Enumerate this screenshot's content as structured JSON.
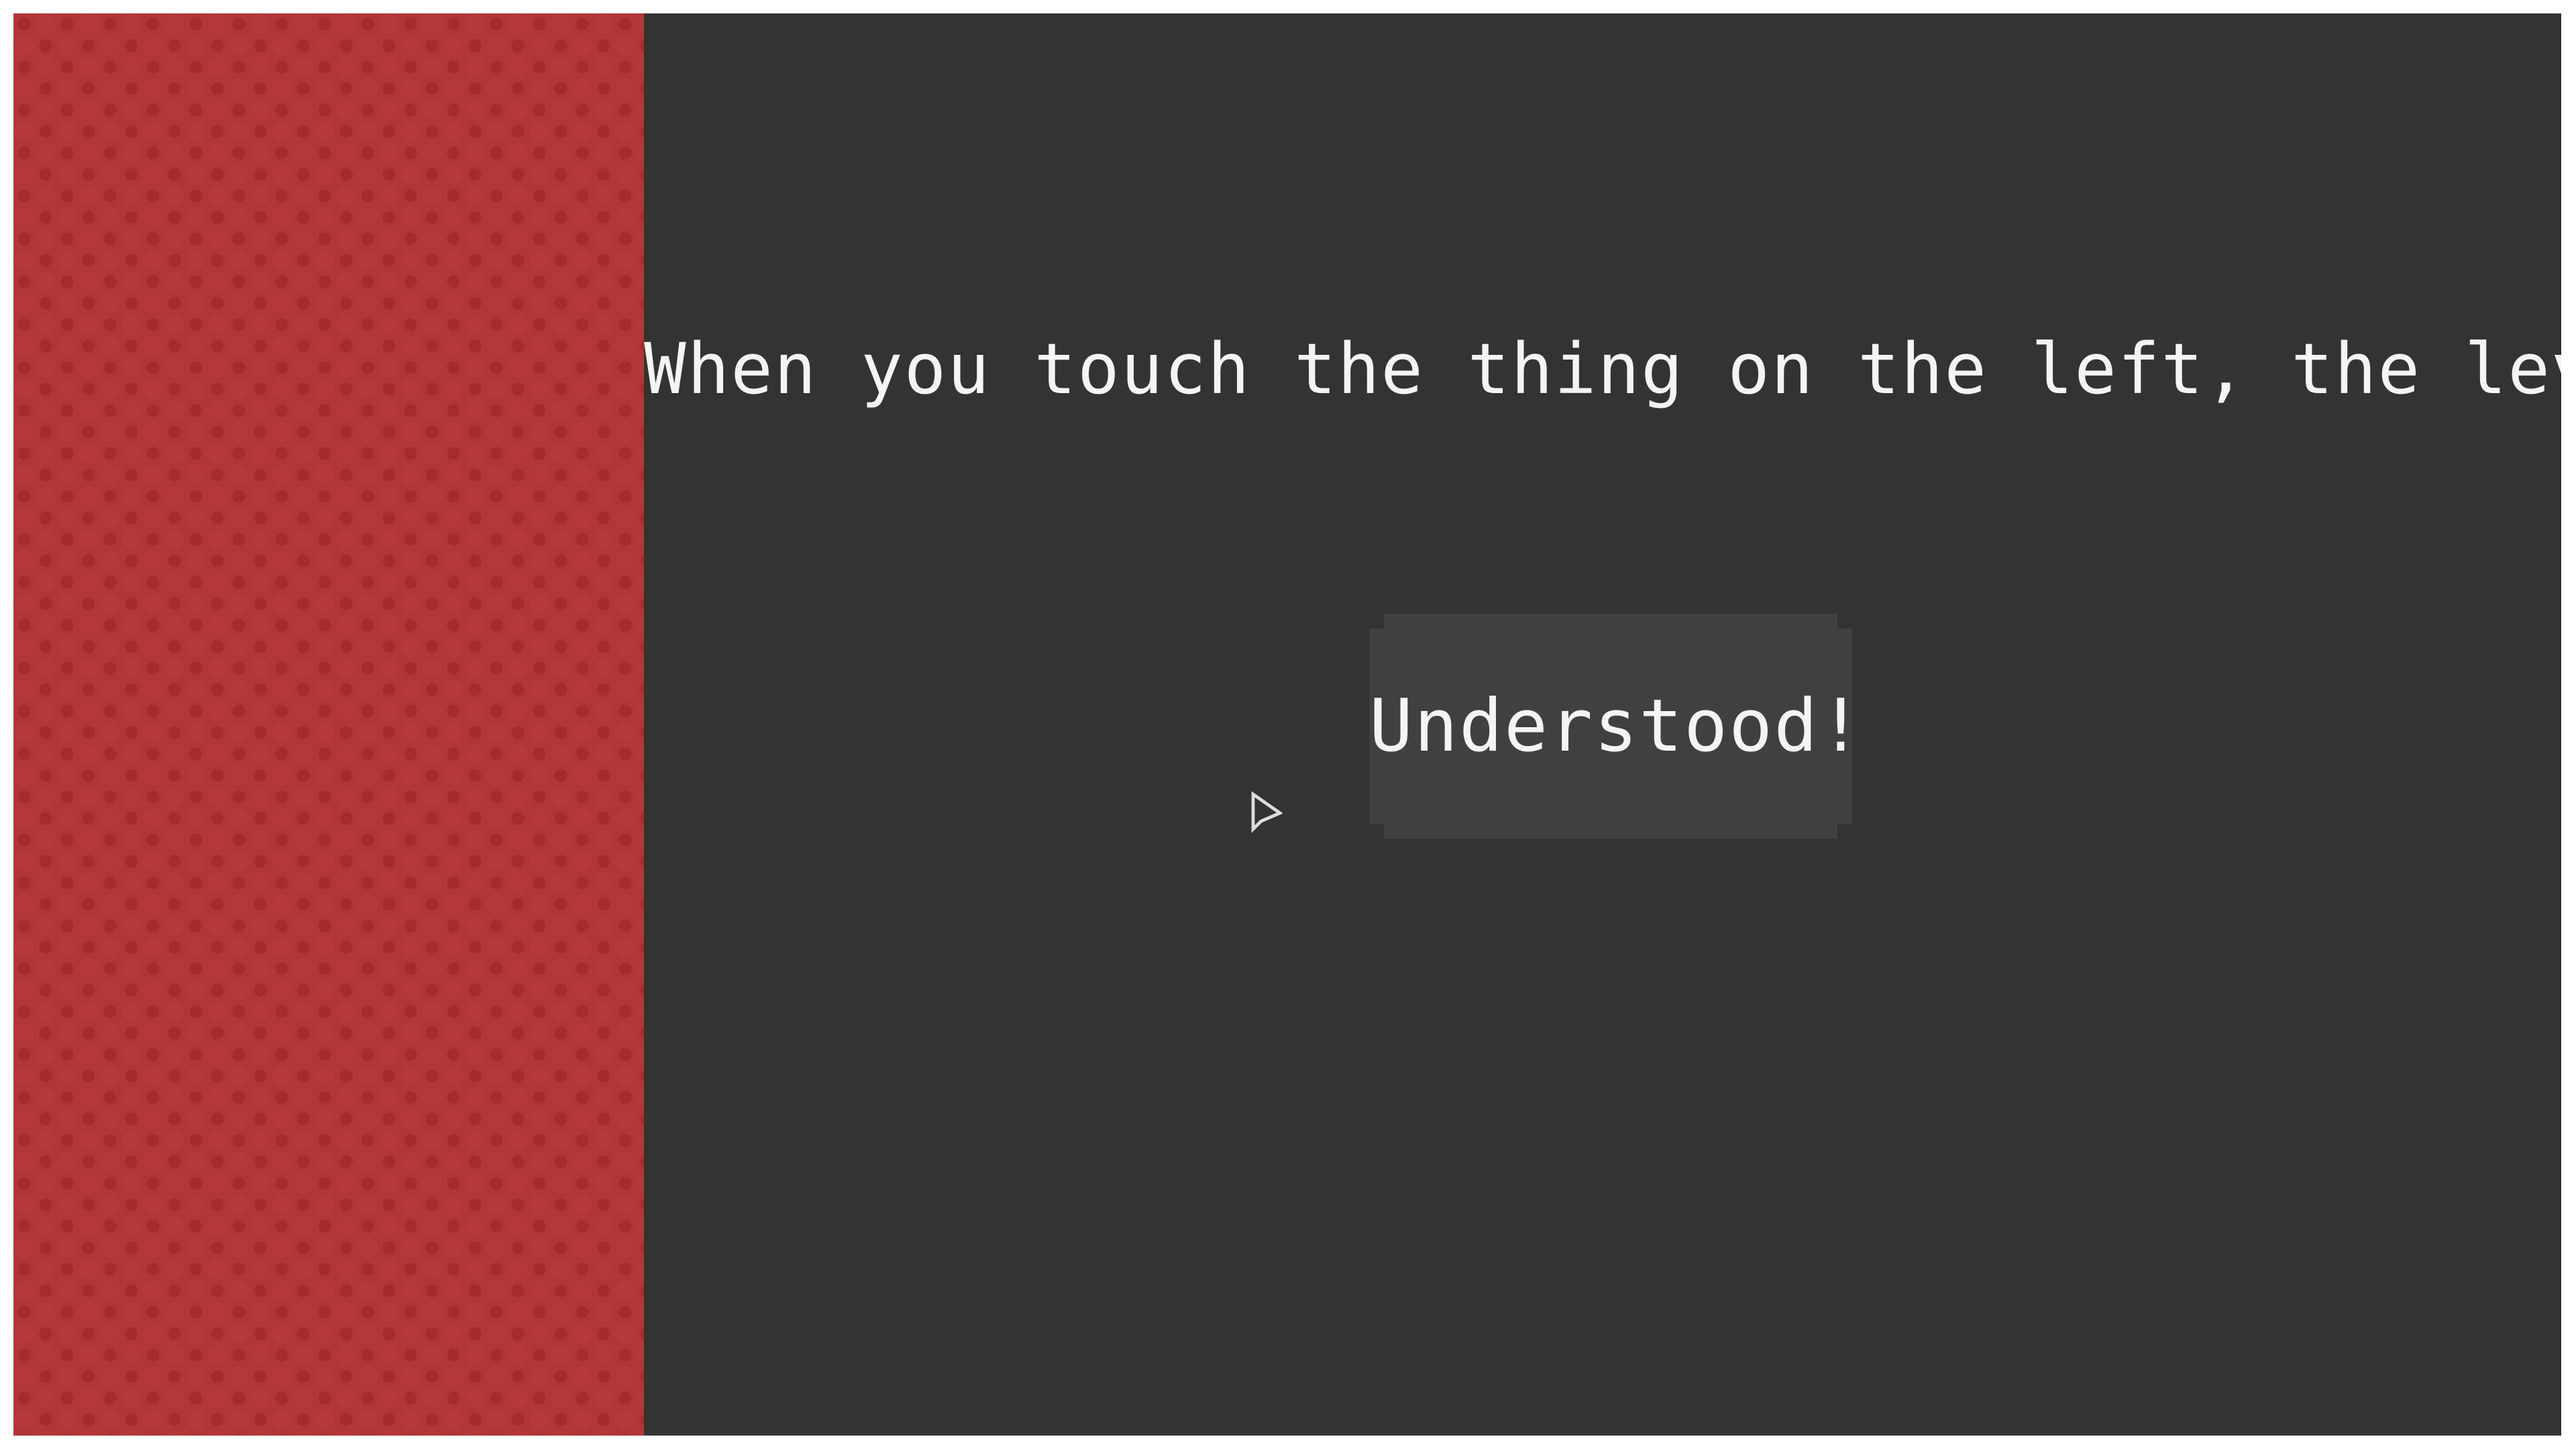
{
  "dialog": {
    "message": "When you touch the thing on the left, the level fails",
    "button_label": "Understood!"
  },
  "hazard": {
    "name": "level-fail-hazard",
    "color": "#b13637"
  },
  "colors": {
    "background": "#333333",
    "button": "#404040",
    "text": "#f4f4f4"
  },
  "cursor": {
    "icon": "pointer-arrow-icon"
  }
}
